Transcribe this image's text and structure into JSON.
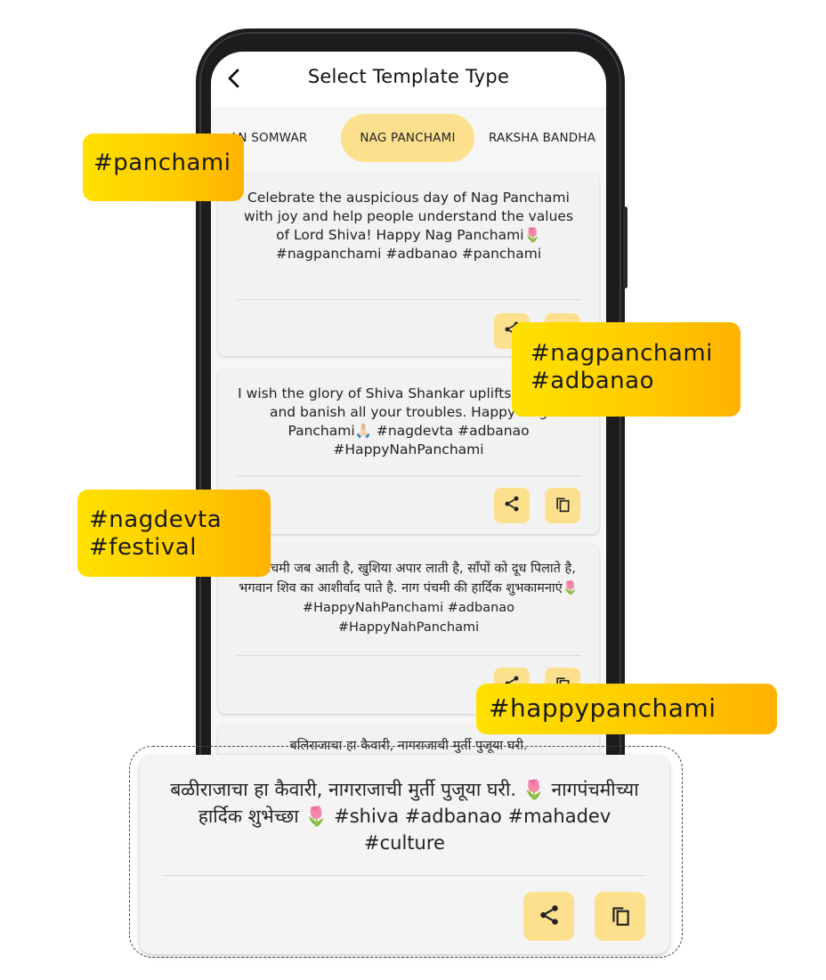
{
  "header": {
    "title": "Select Template Type",
    "back_icon": "chevron-left-icon"
  },
  "tabs": [
    {
      "label": "AN SOMWAR",
      "active": false
    },
    {
      "label": "NAG PANCHAMI",
      "active": true
    },
    {
      "label": "RAKSHA BANDHA",
      "active": false
    }
  ],
  "cards": [
    {
      "text": "Celebrate the auspicious day of Nag Panchami with joy and help people understand the values of Lord Shiva! Happy Nag Panchami🌷 #nagpanchami #adbanao #panchami"
    },
    {
      "text": "I wish the glory of Shiva Shankar uplifts your soul and banish all your troubles. Happy Nag Panchami🙏🏻 #nagdevta #adbanao #HappyNahPanchami"
    },
    {
      "text": "नाग पंचमी जब आती है, खुशिया अपार लाती है, साँपों को दूध पिलाते है, भगवान शिव का आशीर्वाद पाते है. नाग पंचमी की हार्दिक शुभकामनाएं🌷 #HappyNahPanchami #adbanao #HappyNahPanchami"
    },
    {
      "text": "बलिराजाचा हा कैवारी, नागराजाची मुर्ती पुजूया घरी."
    }
  ],
  "tags": [
    {
      "text": "#panchami"
    },
    {
      "text": "#nagpanchami\n#adbanao"
    },
    {
      "text": "#nagdevta\n#festival"
    },
    {
      "text": "#happypanchami"
    }
  ],
  "zoom_card": {
    "text": "बळीराजाचा हा कैवारी, नागराजाची मुर्ती पुजूया घरी. 🌷 नागपंचमीच्या हार्दिक शुभेच्छा 🌷 #shiva #adbanao #mahadev #culture"
  },
  "icons": {
    "share": "share-icon",
    "copy": "copy-icon"
  },
  "colors": {
    "accent": "#fde08d",
    "tag_gradient_start": "#ffe100",
    "tag_gradient_end": "#ffb200",
    "phone_frame": "#1c1c1f"
  }
}
